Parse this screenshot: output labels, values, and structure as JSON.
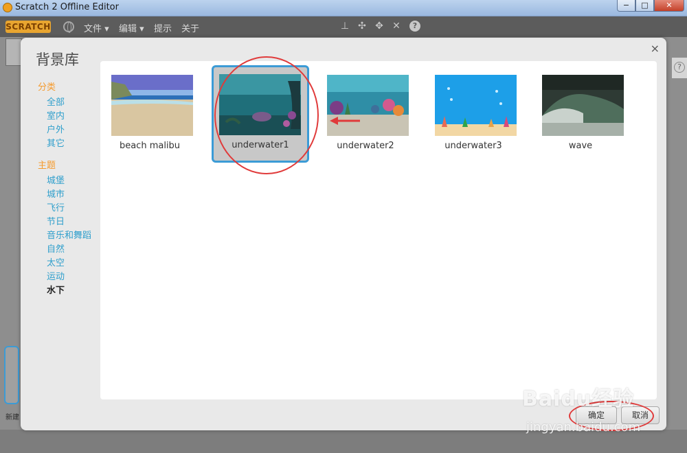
{
  "window": {
    "title": "Scratch 2 Offline Editor",
    "minimize_glyph": "−",
    "maximize_glyph": "□",
    "close_glyph": "✕"
  },
  "menubar": {
    "logo": "SCRATCH",
    "items": [
      "文件 ▾",
      "编辑 ▾",
      "提示",
      "关于"
    ],
    "help_glyph": "?"
  },
  "dialog": {
    "title": "背景库",
    "close_glyph": "×",
    "category_header": "分类",
    "categories": [
      "全部",
      "室内",
      "户外",
      "其它"
    ],
    "theme_header": "主题",
    "themes": [
      "城堡",
      "城市",
      "飞行",
      "节日",
      "音乐和舞蹈",
      "自然",
      "太空",
      "运动",
      "水下"
    ],
    "active_theme": "水下",
    "backdrops": [
      {
        "name": "beach malibu",
        "selected": false
      },
      {
        "name": "underwater1",
        "selected": true
      },
      {
        "name": "underwater2",
        "selected": false
      },
      {
        "name": "underwater3",
        "selected": false
      },
      {
        "name": "wave",
        "selected": false
      }
    ],
    "ok_label": "确定",
    "cancel_label": "取消"
  },
  "editor": {
    "new_backdrop_label": "新建",
    "side_help_glyph": "?"
  },
  "watermark": {
    "brand": "Baidu经验",
    "url": "jingyan.baidu.com"
  },
  "colors": {
    "accent_blue": "#3b9bd6",
    "category_orange": "#f59a2c",
    "link_blue": "#2f9fcc",
    "annotation_red": "#e03a3a"
  }
}
